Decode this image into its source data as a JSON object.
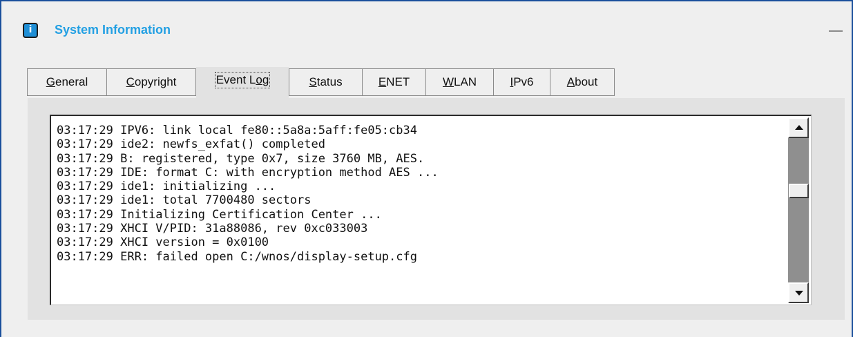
{
  "window": {
    "title": "System Information",
    "info_icon": "info-icon",
    "minimize_icon": "minimize-icon"
  },
  "tabs": [
    {
      "label": "General",
      "mnemonic_index": 0,
      "active": false
    },
    {
      "label": "Copyright",
      "mnemonic_index": 0,
      "active": false
    },
    {
      "label": "Event Log",
      "mnemonic_index": 7,
      "active": true
    },
    {
      "label": "Status",
      "mnemonic_index": 0,
      "active": false
    },
    {
      "label": "ENET",
      "mnemonic_index": 0,
      "active": false
    },
    {
      "label": "WLAN",
      "mnemonic_index": 0,
      "active": false
    },
    {
      "label": "IPv6",
      "mnemonic_index": 0,
      "active": false
    },
    {
      "label": "About",
      "mnemonic_index": 0,
      "active": false
    }
  ],
  "event_log": {
    "lines": [
      "03:17:29 IPV6: link local fe80::5a8a:5aff:fe05:cb34",
      "03:17:29 ide2: newfs_exfat() completed",
      "03:17:29 B: registered, type 0x7, size 3760 MB, AES.",
      "03:17:29 IDE: format C: with encryption method AES ...",
      "03:17:29 ide1: initializing ...",
      "03:17:29 ide1: total 7700480 sectors",
      "03:17:29 Initializing Certification Center ...",
      "03:17:29 XHCI V/PID: 31a88086, rev 0xc033003",
      "03:17:29 XHCI version = 0x0100",
      "03:17:29 ERR: failed open C:/wnos/display-setup.cfg"
    ],
    "scroll_position": 0.35
  },
  "colors": {
    "title": "#23a0e3",
    "border": "#1a4f9c",
    "panel": "#e2e2e2",
    "scroll_track": "#8f8f8f"
  }
}
